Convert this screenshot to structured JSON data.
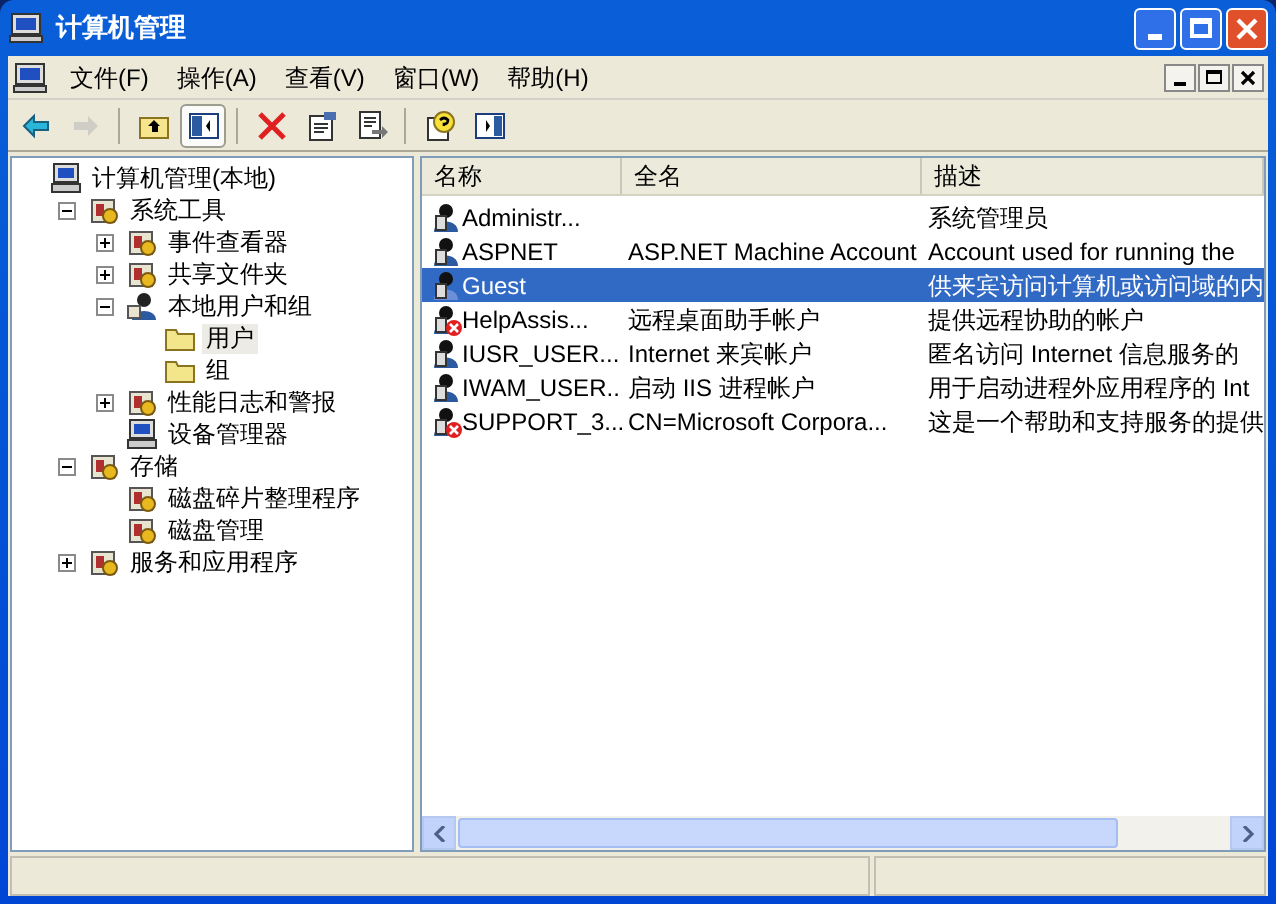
{
  "window": {
    "title": "计算机管理"
  },
  "menu": [
    "文件(F)",
    "操作(A)",
    "查看(V)",
    "窗口(W)",
    "帮助(H)"
  ],
  "toolbar": [
    {
      "kind": "back",
      "disabled": false,
      "pressed": false
    },
    {
      "kind": "forward",
      "disabled": true,
      "pressed": false
    },
    {
      "kind": "separator"
    },
    {
      "kind": "up",
      "disabled": false,
      "pressed": false
    },
    {
      "kind": "tree",
      "disabled": false,
      "pressed": true
    },
    {
      "kind": "separator"
    },
    {
      "kind": "delete",
      "disabled": false,
      "pressed": false
    },
    {
      "kind": "properties",
      "disabled": false,
      "pressed": false
    },
    {
      "kind": "export",
      "disabled": false,
      "pressed": false
    },
    {
      "kind": "separator"
    },
    {
      "kind": "help",
      "disabled": false,
      "pressed": false
    },
    {
      "kind": "pane",
      "disabled": false,
      "pressed": false
    }
  ],
  "tree": [
    {
      "label": "计算机管理(本地)",
      "kind": "computer",
      "selected": false,
      "children": [
        {
          "label": "系统工具",
          "kind": "tool",
          "selected": false,
          "expanded": true,
          "children": [
            {
              "label": "事件查看器",
              "kind": "tool",
              "selected": false,
              "expanded": false
            },
            {
              "label": "共享文件夹",
              "kind": "tool",
              "selected": false,
              "expanded": false
            },
            {
              "label": "本地用户和组",
              "kind": "user",
              "selected": false,
              "expanded": true,
              "children": [
                {
                  "label": "用户",
                  "kind": "folder",
                  "selected": true
                },
                {
                  "label": "组",
                  "kind": "folder",
                  "selected": false
                }
              ]
            },
            {
              "label": "性能日志和警报",
              "kind": "tool",
              "selected": false,
              "expanded": false
            },
            {
              "label": "设备管理器",
              "kind": "computer",
              "selected": false
            }
          ]
        },
        {
          "label": "存储",
          "kind": "tool",
          "selected": false,
          "expanded": true,
          "children": [
            {
              "label": "磁盘碎片整理程序",
              "kind": "tool",
              "selected": false
            },
            {
              "label": "磁盘管理",
              "kind": "tool",
              "selected": false
            }
          ]
        },
        {
          "label": "服务和应用程序",
          "kind": "tool",
          "selected": false,
          "expanded": false
        }
      ]
    }
  ],
  "table": {
    "columns": [
      "名称",
      "全名",
      "描述"
    ],
    "rows": [
      {
        "name": "Administr...",
        "full_name": "",
        "description": "系统管理员",
        "disabled": false,
        "selected": false
      },
      {
        "name": "ASPNET",
        "full_name": "ASP.NET Machine Account",
        "description": "Account used for running the",
        "disabled": false,
        "selected": false
      },
      {
        "name": "Guest",
        "full_name": "",
        "description": "供来宾访问计算机或访问域的内",
        "disabled": false,
        "selected": true
      },
      {
        "name": "HelpAssis...",
        "full_name": "远程桌面助手帐户",
        "description": "提供远程协助的帐户",
        "disabled": true,
        "selected": false
      },
      {
        "name": "IUSR_USER...",
        "full_name": "Internet 来宾帐户",
        "description": "匿名访问 Internet 信息服务的",
        "disabled": false,
        "selected": false
      },
      {
        "name": "IWAM_USER...",
        "full_name": "启动 IIS 进程帐户",
        "description": "用于启动进程外应用程序的 Int",
        "disabled": false,
        "selected": false
      },
      {
        "name": "SUPPORT_3...",
        "full_name": "CN=Microsoft Corpora...",
        "description": "这是一个帮助和支持服务的提供",
        "disabled": true,
        "selected": false
      }
    ]
  }
}
